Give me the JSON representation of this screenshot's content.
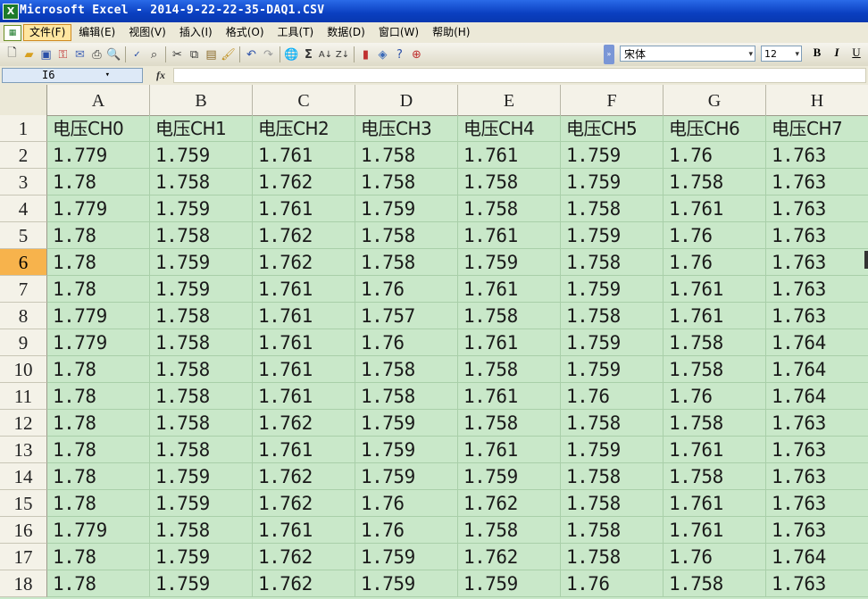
{
  "window": {
    "title": "Microsoft Excel - 2014-9-22-22-35-DAQ1.CSV",
    "app_icon": "excel-icon"
  },
  "menu": [
    {
      "label": "文件(F)",
      "active": true
    },
    {
      "label": "编辑(E)"
    },
    {
      "label": "视图(V)"
    },
    {
      "label": "插入(I)"
    },
    {
      "label": "格式(O)"
    },
    {
      "label": "工具(T)"
    },
    {
      "label": "数据(D)"
    },
    {
      "label": "窗口(W)"
    },
    {
      "label": "帮助(H)"
    }
  ],
  "toolbar": {
    "font_name": "宋体",
    "font_size": "12",
    "bold_label": "B",
    "italic_label": "I",
    "underline_label": "U"
  },
  "formula_bar": {
    "name_box": "I6",
    "fx_label": "fx",
    "formula": ""
  },
  "sheet": {
    "columns": [
      "A",
      "B",
      "C",
      "D",
      "E",
      "F",
      "G",
      "H"
    ],
    "selected_row": "6",
    "rows": [
      {
        "num": "1",
        "cells": [
          "电压CH0",
          "电压CH1",
          "电压CH2",
          "电压CH3",
          "电压CH4",
          "电压CH5",
          "电压CH6",
          "电压CH7"
        ]
      },
      {
        "num": "2",
        "cells": [
          "1.779",
          "1.759",
          "1.761",
          "1.758",
          "1.761",
          "1.759",
          "1.76",
          "1.763"
        ]
      },
      {
        "num": "3",
        "cells": [
          "1.78",
          "1.758",
          "1.762",
          "1.758",
          "1.758",
          "1.759",
          "1.758",
          "1.763"
        ]
      },
      {
        "num": "4",
        "cells": [
          "1.779",
          "1.759",
          "1.761",
          "1.759",
          "1.758",
          "1.758",
          "1.761",
          "1.763"
        ]
      },
      {
        "num": "5",
        "cells": [
          "1.78",
          "1.758",
          "1.762",
          "1.758",
          "1.761",
          "1.759",
          "1.76",
          "1.763"
        ]
      },
      {
        "num": "6",
        "cells": [
          "1.78",
          "1.759",
          "1.762",
          "1.758",
          "1.759",
          "1.758",
          "1.76",
          "1.763"
        ]
      },
      {
        "num": "7",
        "cells": [
          "1.78",
          "1.759",
          "1.761",
          "1.76",
          "1.761",
          "1.759",
          "1.761",
          "1.763"
        ]
      },
      {
        "num": "8",
        "cells": [
          "1.779",
          "1.758",
          "1.761",
          "1.757",
          "1.758",
          "1.758",
          "1.761",
          "1.763"
        ]
      },
      {
        "num": "9",
        "cells": [
          "1.779",
          "1.758",
          "1.761",
          "1.76",
          "1.761",
          "1.759",
          "1.758",
          "1.764"
        ]
      },
      {
        "num": "10",
        "cells": [
          "1.78",
          "1.758",
          "1.761",
          "1.758",
          "1.758",
          "1.759",
          "1.758",
          "1.764"
        ]
      },
      {
        "num": "11",
        "cells": [
          "1.78",
          "1.758",
          "1.761",
          "1.758",
          "1.761",
          "1.76",
          "1.76",
          "1.764"
        ]
      },
      {
        "num": "12",
        "cells": [
          "1.78",
          "1.758",
          "1.762",
          "1.759",
          "1.758",
          "1.758",
          "1.758",
          "1.763"
        ]
      },
      {
        "num": "13",
        "cells": [
          "1.78",
          "1.758",
          "1.761",
          "1.759",
          "1.761",
          "1.759",
          "1.761",
          "1.763"
        ]
      },
      {
        "num": "14",
        "cells": [
          "1.78",
          "1.759",
          "1.762",
          "1.759",
          "1.759",
          "1.758",
          "1.758",
          "1.763"
        ]
      },
      {
        "num": "15",
        "cells": [
          "1.78",
          "1.759",
          "1.762",
          "1.76",
          "1.762",
          "1.758",
          "1.761",
          "1.763"
        ]
      },
      {
        "num": "16",
        "cells": [
          "1.779",
          "1.758",
          "1.761",
          "1.76",
          "1.758",
          "1.758",
          "1.761",
          "1.763"
        ]
      },
      {
        "num": "17",
        "cells": [
          "1.78",
          "1.759",
          "1.762",
          "1.759",
          "1.762",
          "1.758",
          "1.76",
          "1.764"
        ]
      },
      {
        "num": "18",
        "cells": [
          "1.78",
          "1.759",
          "1.762",
          "1.759",
          "1.759",
          "1.76",
          "1.758",
          "1.763"
        ]
      }
    ]
  },
  "colors": {
    "sheet_bg": "#c9e8c9",
    "selected_row_header": "#f7b34c",
    "title_bar": "#0a3fc0"
  }
}
